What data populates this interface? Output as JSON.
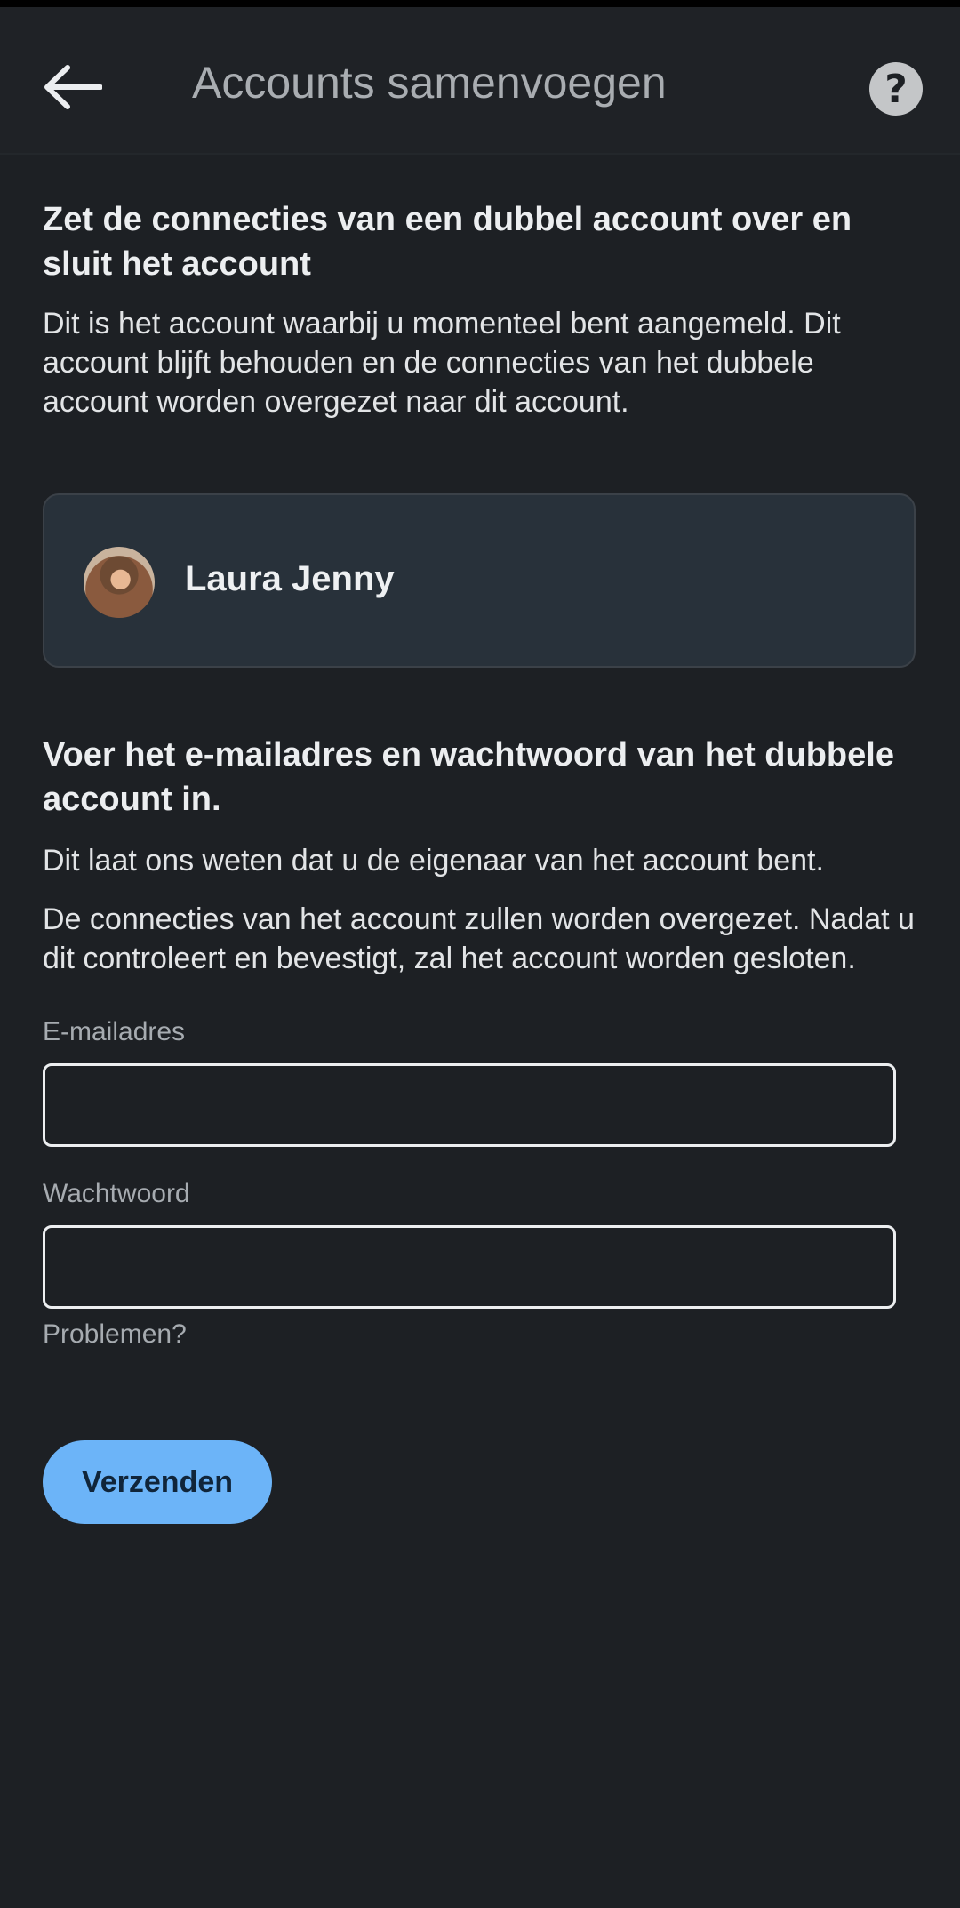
{
  "appbar": {
    "title": "Accounts samenvoegen",
    "back_icon": "arrow-left-icon",
    "help_icon": "question-circle-icon",
    "help_glyph": "?"
  },
  "intro": {
    "heading": "Zet de connecties van een dubbel account over en sluit het account",
    "body": "Dit is het account waarbij u momenteel bent aangemeld. Dit account blijft behouden en de connecties van het dubbele account worden overgezet naar dit account."
  },
  "current_account": {
    "name": "Laura Jenny"
  },
  "form": {
    "heading": "Voer het e-mailadres en wachtwoord van het dubbele account in.",
    "body1": "Dit laat ons weten dat u de eigenaar van het account bent.",
    "body2": "De connecties van het account zullen worden overgezet. Nadat u dit controleert en bevestigt, zal het account worden gesloten.",
    "email_label": "E-mailadres",
    "email_value": "",
    "password_label": "Wachtwoord",
    "password_value": "",
    "problems_link": "Problemen?",
    "submit_label": "Verzenden"
  },
  "colors": {
    "background": "#1d2024",
    "card": "#28313a",
    "accent": "#6cb4f8"
  }
}
